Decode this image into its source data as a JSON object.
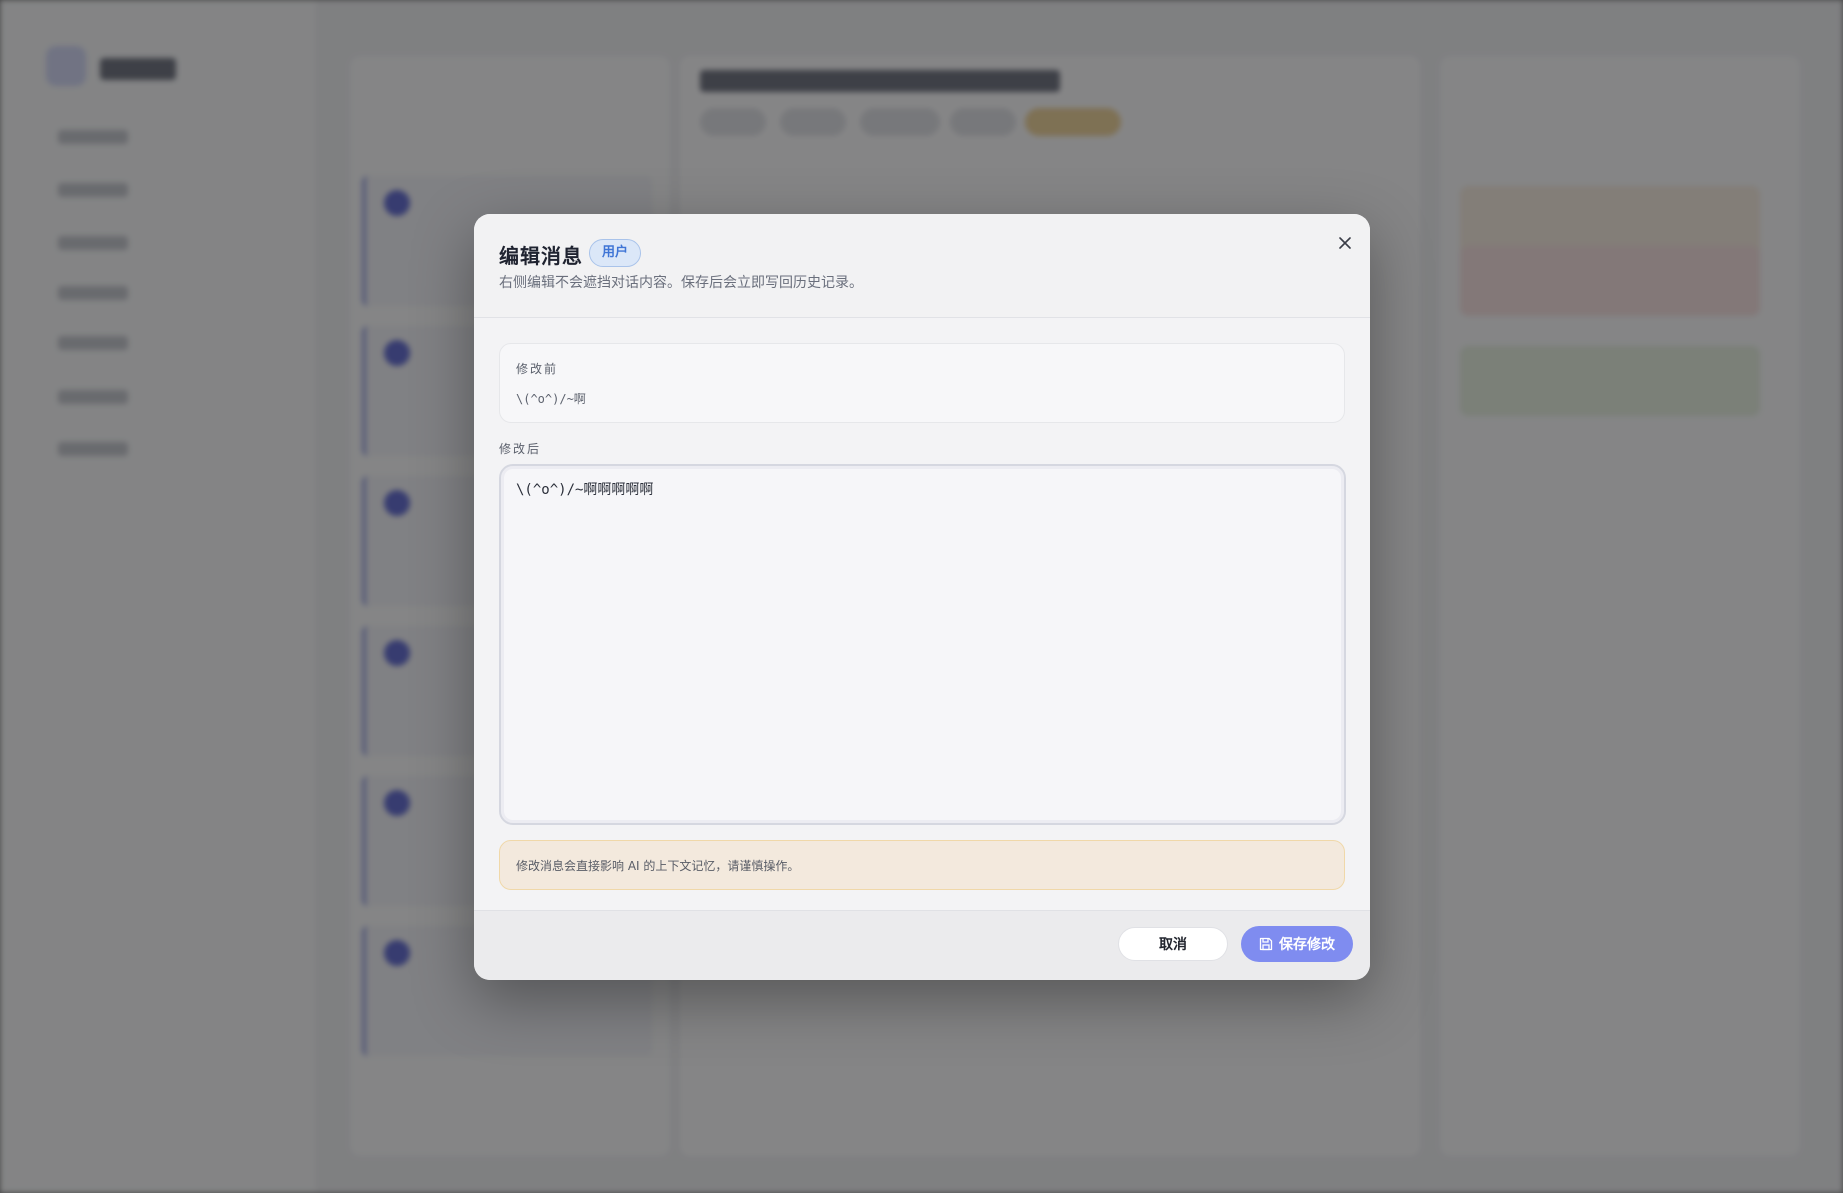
{
  "modal": {
    "title": "编辑消息",
    "role_badge": "用户",
    "subtitle": "右侧编辑不会遮挡对话内容。保存后会立即写回历史记录。",
    "close_icon": "close-icon"
  },
  "before": {
    "label": "修改前",
    "text": "\\(^o^)/~啊"
  },
  "after": {
    "label": "修改后",
    "value": "\\(^o^)/~啊啊啊啊啊"
  },
  "warning": {
    "text": "修改消息会直接影响 AI 的上下文记忆，请谨慎操作。"
  },
  "footer": {
    "cancel_label": "取消",
    "save_label": "保存修改",
    "save_icon": "save-icon"
  },
  "colors": {
    "accent": "#7f8cf0",
    "badge_text": "#3f75d6",
    "warning_bg": "#f3e9dd"
  }
}
